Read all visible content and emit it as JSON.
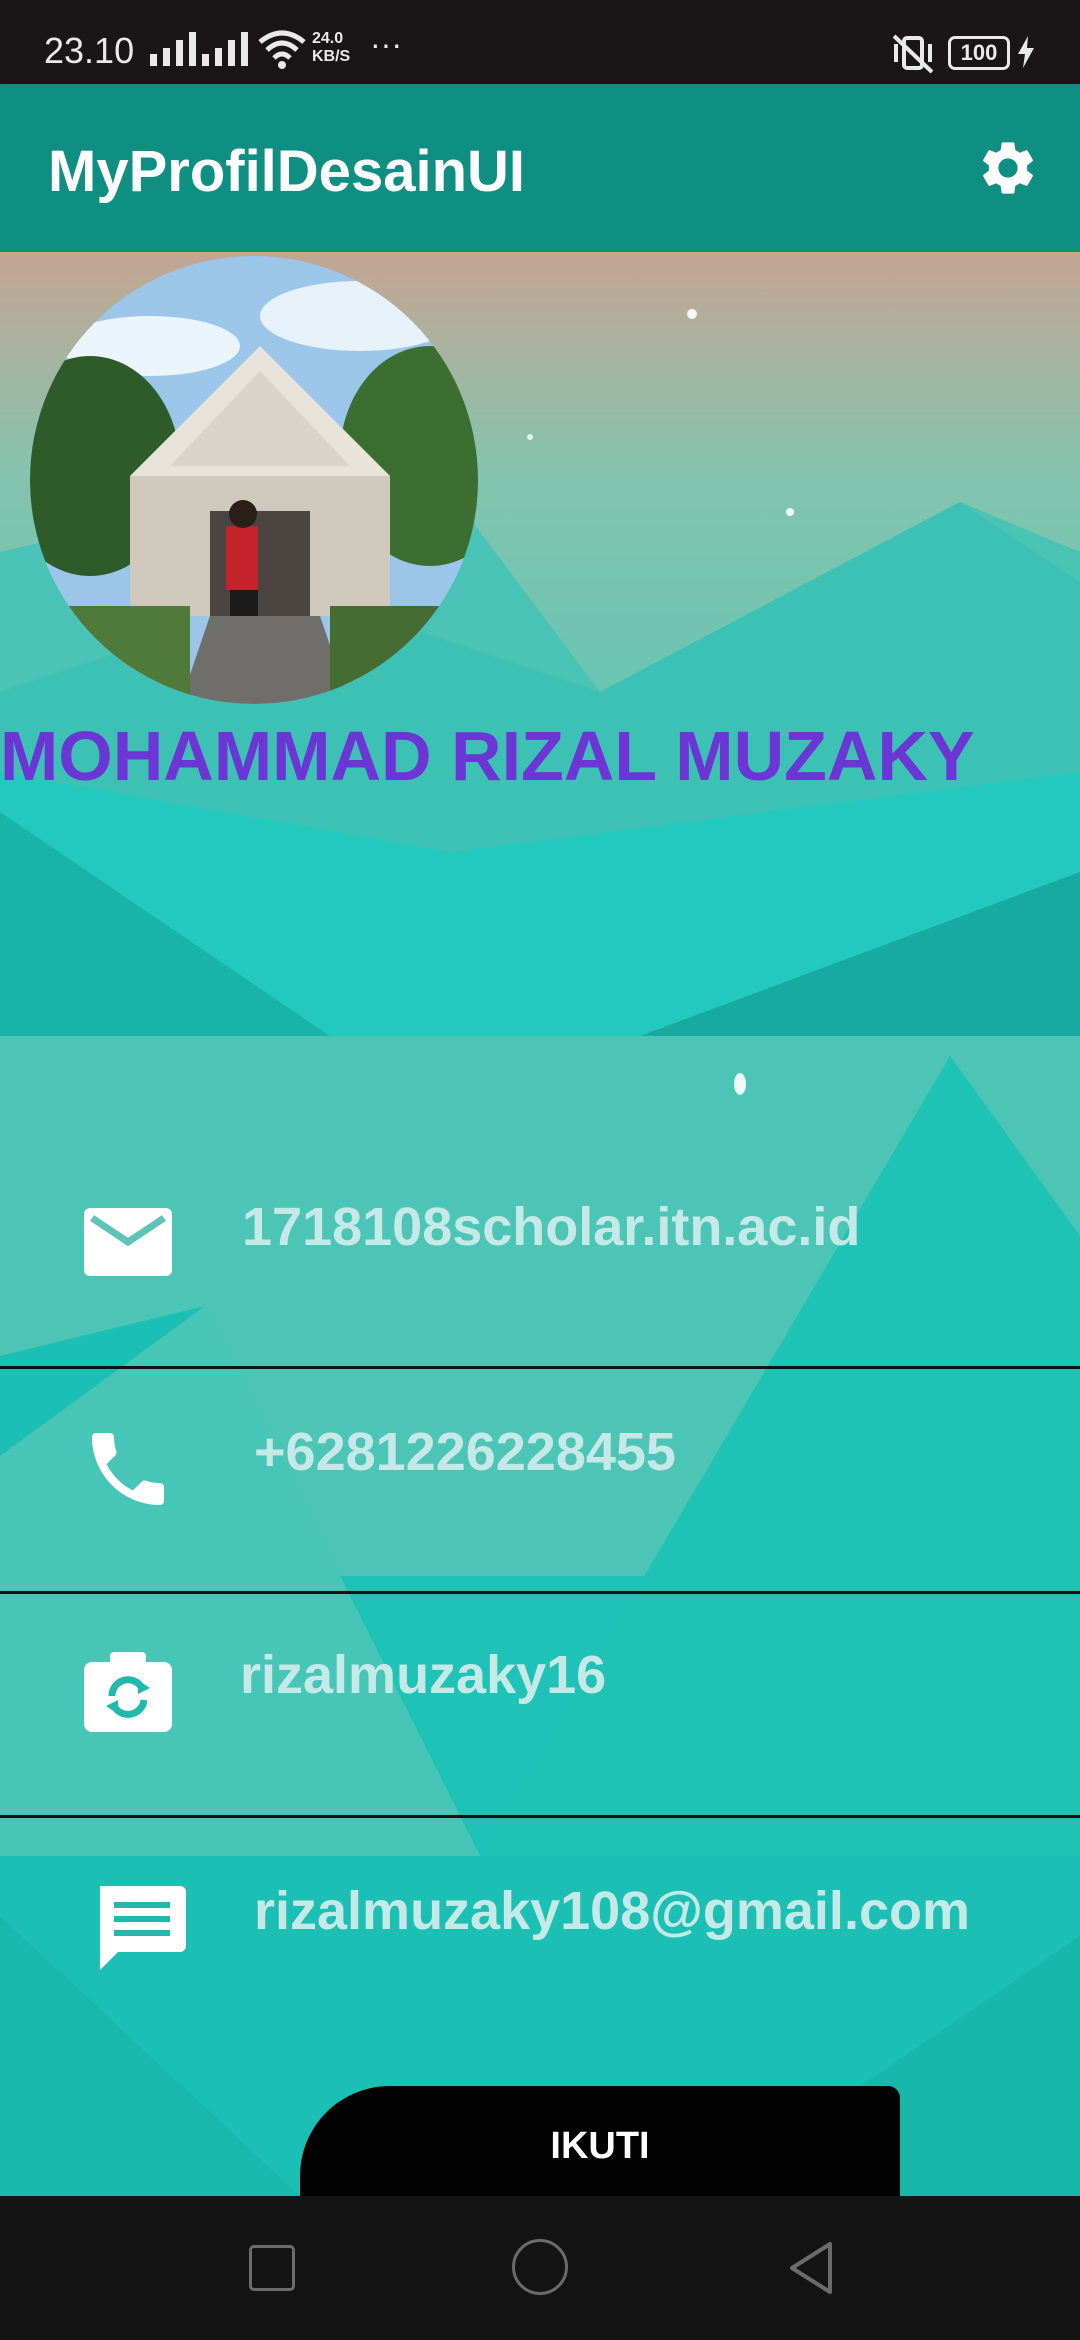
{
  "status_bar": {
    "time": "23.10",
    "net_speed_value": "24.0",
    "net_speed_unit": "KB/S",
    "more": "···",
    "battery": "100"
  },
  "app_bar": {
    "title": "MyProfilDesainUI",
    "settings_icon": "gear-icon"
  },
  "profile": {
    "name": "MOHAMMAD RIZAL MUZAKY"
  },
  "contacts": [
    {
      "icon": "mail-icon",
      "value": "1718108scholar.itn.ac.id"
    },
    {
      "icon": "phone-icon",
      "value": "+6281226228455"
    },
    {
      "icon": "camera-icon",
      "value": "rizalmuzaky16"
    },
    {
      "icon": "message-icon",
      "value": "rizalmuzaky108@gmail.com"
    }
  ],
  "follow_button": {
    "label": "IKUTI"
  },
  "colors": {
    "app_bar": "#0f8f82",
    "name": "#6c35d6",
    "contact_text": "#c5e9e6",
    "button": "#020202"
  }
}
